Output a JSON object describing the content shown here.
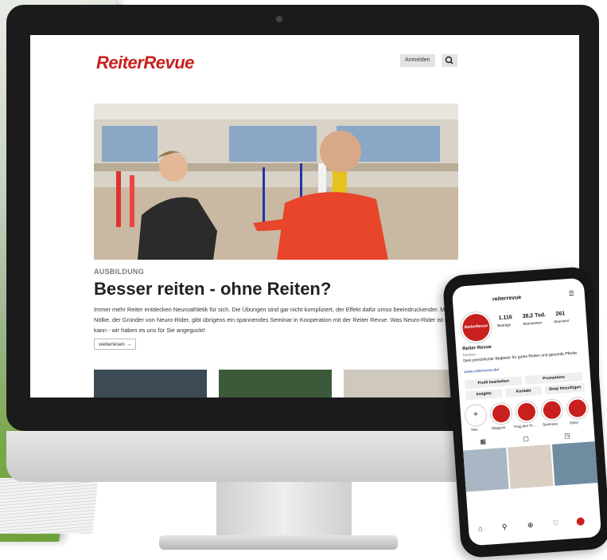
{
  "website": {
    "logo": "ReiterRevue",
    "login_label": "Anmelden",
    "search_icon": "search-icon",
    "article": {
      "kicker": "AUSBILDUNG",
      "headline": "Besser reiten - ohne Reiten?",
      "teaser": "Immer mehr Reiter entdecken Neuroathletik für sich. Die Übungen sind gar nicht kompliziert, der Effekt dafür umso beeindruckender. Marc Nölke, der Gründer von Neuro-Rider, gibt übrigens ein spannendes Seminar in Kooperation mit der Reiter Revue. Was Neuro-Rider ist und kann - wir haben es uns für Sie angeguckt!",
      "more_label": "weiterlesen →"
    }
  },
  "instagram": {
    "username": "reiterrevue",
    "avatar_text": "ReiterRevue",
    "posts_count": "1.116",
    "posts_label": "Beiträge",
    "followers_count": "38,2 Tsd.",
    "followers_label": "Abonnenten",
    "following_count": "261",
    "following_label": "Abonniert",
    "name": "Reiter Revue",
    "category": "Medien",
    "bio": "Dein persönlicher Begleiter für gutes Reiten und gesunde Pferde.",
    "website": "www.reiterrevue.de/",
    "buttons": {
      "edit_profile": "Profil bearbeiten",
      "promotions": "Promotions",
      "insights": "Insights",
      "contact": "Kontakt",
      "shop": "Shop hinzufügen"
    },
    "highlights": [
      {
        "label": "Neu"
      },
      {
        "label": "Magazin"
      },
      {
        "label": "Frag den Pr..."
      },
      {
        "label": "Seminare"
      },
      {
        "label": "Ayley"
      }
    ]
  },
  "colors": {
    "brand_red": "#c8201e"
  }
}
